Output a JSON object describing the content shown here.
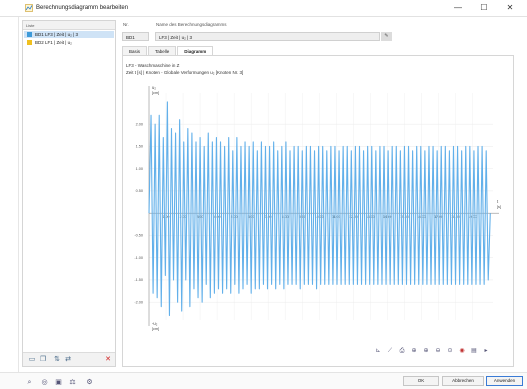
{
  "window": {
    "title": "Berechnungsdiagramm bearbeiten",
    "minimize": "—",
    "maximize": "☐",
    "close": "✕"
  },
  "list": {
    "header": "Liste",
    "items": [
      {
        "id": "BD1",
        "label": "LF3 | Zeit | u₂ | 3",
        "color": "#3d9ad9",
        "selected": true
      },
      {
        "id": "BD2",
        "label": "LF1 | Zeit | u₂",
        "color": "#f0c020",
        "selected": false
      }
    ]
  },
  "fields": {
    "no_label": "Nr.",
    "no_value": "BD1",
    "name_label": "Name des Berechnungsdiagramms",
    "name_value": "LF3 | Zeit | u₂ | 3"
  },
  "tabs": [
    "Basis",
    "Tabelle",
    "Diagramm"
  ],
  "active_tab": "Diagramm",
  "chart_heading": {
    "line1": "LF3 - Waschmaschine in Z",
    "line2": "Zeit t [s] | Knoten - Globale Verformungen u₂ [Knoten Nr. 3]"
  },
  "chart_data": {
    "type": "line",
    "x_axis_label": "t",
    "x_axis_unit": "[s]",
    "y_axis_label": "u₂",
    "y_axis_unit": "[cm]",
    "y_axis_label_neg": "-u₂",
    "ylim": [
      -2.4,
      2.7
    ],
    "xlim": [
      0,
      20.2
    ],
    "y_ticks": [
      2.0,
      1.5,
      1.0,
      0.5,
      -0.5,
      -1.0,
      -1.5,
      -2.0
    ],
    "y_tick_labels": [
      "2.00",
      "1.50",
      "1.00",
      "0.50",
      "-0.50",
      "-1.00",
      "-1.50",
      "-2.00"
    ],
    "x_ticks": [
      1,
      2,
      3,
      4,
      5,
      6,
      7,
      8,
      9,
      10,
      11,
      12,
      13,
      14,
      15,
      16,
      17,
      18,
      19
    ],
    "x_tick_labels": [
      "1.00",
      "2.00",
      "3.00",
      "4.00",
      "5.00",
      "6.00",
      "7.00",
      "8.00",
      "9.00",
      "10.00",
      "11.00",
      "12.00",
      "13.00",
      "14.00",
      "15.00",
      "16.00",
      "17.00",
      "18.00",
      "19.00"
    ],
    "grid": true,
    "line_color": "#62b0ea",
    "series": [
      {
        "values": [
          [
            0.0,
            0.0
          ],
          [
            0.12,
            2.2
          ],
          [
            0.24,
            -1.8
          ],
          [
            0.36,
            2.0
          ],
          [
            0.48,
            -1.9
          ],
          [
            0.6,
            2.2
          ],
          [
            0.72,
            -2.1
          ],
          [
            0.84,
            1.7
          ],
          [
            0.96,
            -1.4
          ],
          [
            1.08,
            2.5
          ],
          [
            1.2,
            -2.3
          ],
          [
            1.32,
            1.9
          ],
          [
            1.44,
            -1.5
          ],
          [
            1.56,
            1.8
          ],
          [
            1.68,
            -2.0
          ],
          [
            1.8,
            2.1
          ],
          [
            1.92,
            -2.2
          ],
          [
            2.04,
            1.6
          ],
          [
            2.16,
            -1.5
          ],
          [
            2.28,
            1.9
          ],
          [
            2.4,
            -2.1
          ],
          [
            2.52,
            1.8
          ],
          [
            2.64,
            -1.7
          ],
          [
            2.76,
            1.6
          ],
          [
            2.88,
            -1.9
          ],
          [
            3.0,
            1.7
          ],
          [
            3.12,
            -2.0
          ],
          [
            3.24,
            1.5
          ],
          [
            3.36,
            -1.6
          ],
          [
            3.48,
            1.8
          ],
          [
            3.6,
            -1.9
          ],
          [
            3.72,
            1.6
          ],
          [
            3.84,
            -1.8
          ],
          [
            3.96,
            1.7
          ],
          [
            4.08,
            -1.7
          ],
          [
            4.2,
            1.6
          ],
          [
            4.32,
            -1.8
          ],
          [
            4.44,
            1.5
          ],
          [
            4.56,
            -1.7
          ],
          [
            4.68,
            1.7
          ],
          [
            4.8,
            -1.8
          ],
          [
            4.92,
            1.4
          ],
          [
            5.04,
            -1.6
          ],
          [
            5.16,
            1.7
          ],
          [
            5.28,
            -1.8
          ],
          [
            5.4,
            1.5
          ],
          [
            5.52,
            -1.7
          ],
          [
            5.64,
            1.6
          ],
          [
            5.76,
            -1.6
          ],
          [
            5.88,
            1.5
          ],
          [
            6.0,
            -1.8
          ],
          [
            6.12,
            1.6
          ],
          [
            6.24,
            -1.7
          ],
          [
            6.36,
            1.4
          ],
          [
            6.48,
            -1.7
          ],
          [
            6.6,
            1.6
          ],
          [
            6.72,
            -1.6
          ],
          [
            6.84,
            1.5
          ],
          [
            6.96,
            -1.7
          ],
          [
            7.08,
            1.5
          ],
          [
            7.2,
            -1.6
          ],
          [
            7.32,
            1.6
          ],
          [
            7.44,
            -1.7
          ],
          [
            7.56,
            1.4
          ],
          [
            7.68,
            -1.6
          ],
          [
            7.8,
            1.5
          ],
          [
            7.92,
            -1.7
          ],
          [
            8.04,
            1.6
          ],
          [
            8.16,
            -1.6
          ],
          [
            8.28,
            1.4
          ],
          [
            8.4,
            -1.6
          ],
          [
            8.52,
            1.5
          ],
          [
            8.64,
            -1.6
          ],
          [
            8.76,
            1.5
          ],
          [
            8.88,
            -1.7
          ],
          [
            9.0,
            1.4
          ],
          [
            9.12,
            -1.6
          ],
          [
            9.24,
            1.5
          ],
          [
            9.36,
            -1.6
          ],
          [
            9.48,
            1.5
          ],
          [
            9.6,
            -1.6
          ],
          [
            9.72,
            1.4
          ],
          [
            9.84,
            -1.7
          ],
          [
            9.96,
            1.5
          ],
          [
            10.08,
            -1.6
          ],
          [
            10.2,
            1.5
          ],
          [
            10.32,
            -1.6
          ],
          [
            10.44,
            1.4
          ],
          [
            10.56,
            -1.6
          ],
          [
            10.68,
            1.5
          ],
          [
            10.8,
            -1.6
          ],
          [
            10.92,
            1.5
          ],
          [
            11.04,
            -1.6
          ],
          [
            11.16,
            1.4
          ],
          [
            11.28,
            -1.6
          ],
          [
            11.4,
            1.5
          ],
          [
            11.52,
            -1.6
          ],
          [
            11.64,
            1.5
          ],
          [
            11.76,
            -1.6
          ],
          [
            11.88,
            1.4
          ],
          [
            12.0,
            -1.6
          ],
          [
            12.12,
            1.5
          ],
          [
            12.24,
            -1.6
          ],
          [
            12.36,
            1.5
          ],
          [
            12.48,
            -1.6
          ],
          [
            12.6,
            1.4
          ],
          [
            12.72,
            -1.6
          ],
          [
            12.84,
            1.5
          ],
          [
            12.96,
            -1.6
          ],
          [
            13.08,
            1.5
          ],
          [
            13.2,
            -1.6
          ],
          [
            13.32,
            1.4
          ],
          [
            13.44,
            -1.6
          ],
          [
            13.56,
            1.5
          ],
          [
            13.68,
            -1.6
          ],
          [
            13.8,
            1.5
          ],
          [
            13.92,
            -1.6
          ],
          [
            14.04,
            1.4
          ],
          [
            14.16,
            -1.6
          ],
          [
            14.28,
            1.5
          ],
          [
            14.4,
            -1.6
          ],
          [
            14.52,
            1.5
          ],
          [
            14.64,
            -1.6
          ],
          [
            14.76,
            1.4
          ],
          [
            14.88,
            -1.6
          ],
          [
            15.0,
            1.5
          ],
          [
            15.12,
            -1.6
          ],
          [
            15.24,
            1.5
          ],
          [
            15.36,
            -1.6
          ],
          [
            15.48,
            1.4
          ],
          [
            15.6,
            -1.6
          ],
          [
            15.72,
            1.5
          ],
          [
            15.84,
            -1.6
          ],
          [
            15.96,
            1.5
          ],
          [
            16.08,
            -1.6
          ],
          [
            16.2,
            1.4
          ],
          [
            16.32,
            -1.6
          ],
          [
            16.44,
            1.5
          ],
          [
            16.56,
            -1.6
          ],
          [
            16.68,
            1.5
          ],
          [
            16.8,
            -1.6
          ],
          [
            16.92,
            1.4
          ],
          [
            17.04,
            -1.6
          ],
          [
            17.16,
            1.5
          ],
          [
            17.28,
            -1.6
          ],
          [
            17.4,
            1.5
          ],
          [
            17.52,
            -1.6
          ],
          [
            17.64,
            1.4
          ],
          [
            17.76,
            -1.6
          ],
          [
            17.88,
            1.5
          ],
          [
            18.0,
            -1.6
          ],
          [
            18.12,
            1.5
          ],
          [
            18.24,
            -1.6
          ],
          [
            18.36,
            1.4
          ],
          [
            18.48,
            -1.6
          ],
          [
            18.6,
            1.5
          ],
          [
            18.72,
            -1.6
          ],
          [
            18.84,
            1.5
          ],
          [
            18.96,
            -1.6
          ],
          [
            19.08,
            1.4
          ],
          [
            19.2,
            -1.6
          ],
          [
            19.32,
            1.5
          ],
          [
            19.44,
            -1.6
          ],
          [
            19.56,
            1.5
          ],
          [
            19.68,
            -1.6
          ],
          [
            19.8,
            1.4
          ],
          [
            19.92,
            -1.5
          ],
          [
            20.04,
            0.0
          ]
        ]
      }
    ]
  },
  "buttons": {
    "ok": "OK",
    "cancel": "Abbrechen",
    "apply": "Anwenden"
  },
  "icons": {
    "list_toolbar": [
      "new-item-icon",
      "copy-item-icon",
      "sort-icon",
      "export-icon",
      "delete-icon"
    ],
    "chart_toolbar": [
      "axis-settings-icon",
      "line-settings-icon",
      "print-icon",
      "zoom-fit-icon",
      "zoom-in-icon",
      "zoom-out-icon",
      "zoom-window-icon",
      "reset-view-icon",
      "export-image-icon",
      "more-icon"
    ],
    "bottom_toolbar": [
      "search-icon",
      "info-icon",
      "view-icon",
      "units-icon",
      "settings-icon"
    ]
  }
}
